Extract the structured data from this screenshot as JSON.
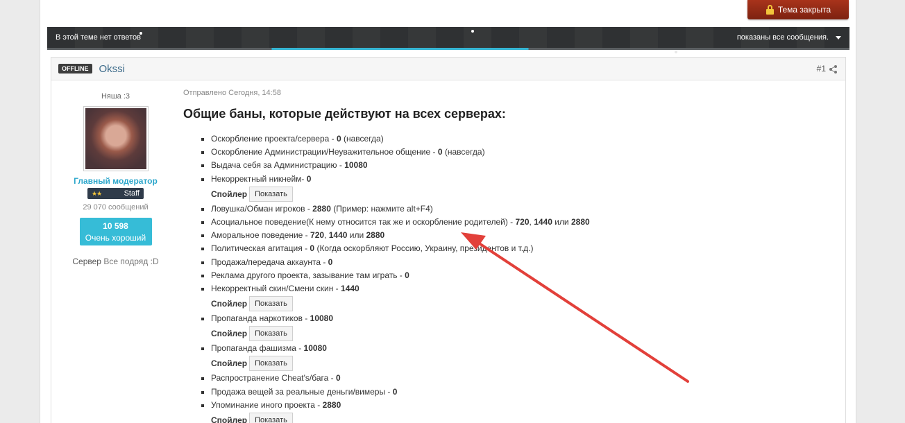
{
  "topic": {
    "closed_label": "Тема закрыта",
    "no_replies": "В этой теме нет ответов",
    "filter_label": "показаны все сообщения."
  },
  "post": {
    "status": "OFFLINE",
    "author": "Okssi",
    "number": "#1",
    "author_title": "Няша :3",
    "role": "Главный модератор",
    "group": "Staff",
    "post_count": "29 070 сообщений",
    "reputation": "10 598",
    "reputation_label": "Очень хороший",
    "server_label": "Сервер",
    "server_value": "Все подряд :D",
    "posted": "Отправлено Сегодня, 14:58",
    "heading": "Общие баны, которые действуют на всех серверах:",
    "spoiler_label": "Спойлер",
    "spoiler_button": "Показать",
    "items": [
      {
        "type": "item",
        "text": "Оскорбление проекта/сервера - ",
        "bold": "0",
        "rest": "  (навсегда)"
      },
      {
        "type": "item",
        "text": "Оскорбление Администрации/Неуважительное общение - ",
        "bold": "0",
        "rest": " (навсегда)"
      },
      {
        "type": "item",
        "text": "Выдача себя за Администрацию - ",
        "bold": "10080",
        "rest": ""
      },
      {
        "type": "item",
        "text": "Некорректный никнейм- ",
        "bold": "0",
        "rest": ""
      },
      {
        "type": "spoiler"
      },
      {
        "type": "item",
        "text": "Ловушка/Обман игроков - ",
        "bold": "2880",
        "rest": " (Пример: нажмите alt+F4)"
      },
      {
        "type": "item",
        "text": "Асоциальное поведение(К нему относится так же и оскорбление родителей) - ",
        "bold": "720",
        "rest": ", ",
        "bold2": "1440",
        "rest2": " или ",
        "bold3": "2880"
      },
      {
        "type": "item",
        "text": "Аморальное поведение - ",
        "bold": "720",
        "rest": ", ",
        "bold2": "1440",
        "rest2": " или ",
        "bold3": "2880"
      },
      {
        "type": "item",
        "text": "Политическая агитация - ",
        "bold": "0",
        "rest": " (Когда оскорбляют Россию, Украину, президентов и т.д.)"
      },
      {
        "type": "item",
        "text": "Продажа/передача аккаунта - ",
        "bold": "0",
        "rest": ""
      },
      {
        "type": "item",
        "text": "Реклама другого проекта, зазывание там играть - ",
        "bold": "0",
        "rest": ""
      },
      {
        "type": "item",
        "text": "Некорректный скин/Смени скин - ",
        "bold": "1440",
        "rest": ""
      },
      {
        "type": "spoiler"
      },
      {
        "type": "item",
        "text": "Пропаганда наркотиков - ",
        "bold": "10080",
        "rest": ""
      },
      {
        "type": "spoiler"
      },
      {
        "type": "item",
        "text": "Пропаганда фашизма - ",
        "bold": "10080",
        "rest": ""
      },
      {
        "type": "spoiler"
      },
      {
        "type": "item",
        "text": "Распространение Cheat's/бага - ",
        "bold": "0",
        "rest": ""
      },
      {
        "type": "item",
        "text": "Продажа вещей за реальные деньги/вимеры - ",
        "bold": "0",
        "rest": ""
      },
      {
        "type": "item",
        "text": "Упоминание иного проекта - ",
        "bold": "2880",
        "rest": ""
      },
      {
        "type": "spoiler"
      }
    ]
  },
  "colors": {
    "accent": "#36bcd7",
    "closed_button": "#8f2914",
    "annotation_arrow": "#e2403a"
  }
}
